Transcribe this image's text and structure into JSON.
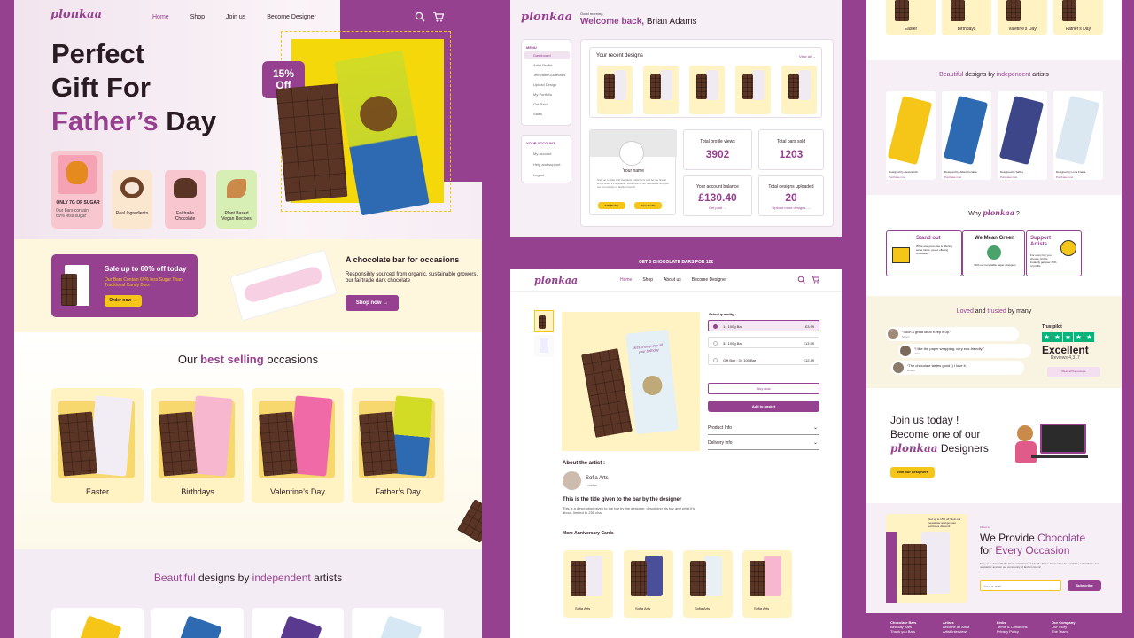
{
  "brand": "plonkaa",
  "p1": {
    "nav": [
      "Home",
      "Shop",
      "Join us",
      "Become Designer"
    ],
    "hero_l1": "Perfect",
    "hero_l2": "Gift For",
    "hero_l3a": "Father’s",
    "hero_l3b": " Day",
    "badge": [
      "15%",
      "Off"
    ],
    "features": [
      {
        "title": "ONLY 7G OF SUGAR",
        "desc": "Our bars contain 69% less sugar"
      },
      {
        "title": "Real Ingredients"
      },
      {
        "title": "Fairtrade Chocolate"
      },
      {
        "title": "Plant Based Vegan Recipes"
      }
    ],
    "promo": {
      "title": "Sale up to 60% off today",
      "sub": "Our Bars Contain 69% less Sugar Than Traditional Candy Bars",
      "btn": "Order now →"
    },
    "occ": {
      "title": "A chocolate bar for occasions",
      "desc": "Responsibly sourced from organic, sustainable growers, our fairtrade dark chocolate",
      "btn": "Shop now →"
    },
    "best_a": "Our ",
    "best_b": "best selling",
    "best_c": " occasions",
    "cards": [
      "Easter",
      "Birthdays",
      "Valentine’s Day",
      "Father’s Day"
    ],
    "designs_a": "Beautiful",
    "designs_b": " designs by ",
    "designs_c": "independent",
    "designs_d": " artists"
  },
  "p2": {
    "greet": "Good morning,",
    "welcome": "Welcome back,",
    "name": "Brian Adams",
    "menu_h": "MENU",
    "menu": [
      "Dashboard",
      "Artist Profile",
      "Template Guidelines",
      "Upload Design",
      "My Portfolio",
      "Get Paid",
      "Sales"
    ],
    "acct_h": "YOUR ACCOUNT",
    "acct": [
      "My account",
      "Help and support",
      "Logout"
    ],
    "recent": "Your recent designs",
    "view_all": "View all →",
    "your_name": "Your name",
    "profile_desc": "Stay up to date with the latest collections and be the first to know when it's available, subscribe to our newsletter and join our community of fashion lovers!",
    "edit": "Edit Profile",
    "view": "View Profile",
    "stats": [
      {
        "label": "Total profile views",
        "value": "3902"
      },
      {
        "label": "Total bars sold",
        "value": "1203"
      },
      {
        "label": "Your account balance",
        "value": "£130.40",
        "link": "Get paid →"
      },
      {
        "label": "Total designs uploaded",
        "value": "20",
        "link": "Upload more designs →"
      }
    ]
  },
  "p3": {
    "banner": "GET 3 CHOCOLATE BARS FOR 12£",
    "nav": [
      "Home",
      "Shop",
      "About us",
      "Become Designer"
    ],
    "qty": "Select quantity :",
    "opts": [
      {
        "l": "1× 100g Bar",
        "p": "£3.99"
      },
      {
        "l": "3× 100g Bar",
        "p": "£13.99"
      },
      {
        "l": "Gift Box : 3× 100 Bar",
        "p": "£12.49"
      }
    ],
    "buy": "Buy now",
    "add": "Add to basket",
    "acc": [
      "Product Info",
      "Delivery info"
    ],
    "about": "About the artist :",
    "artist": "Sofia Arts",
    "loc": "London",
    "ttl": "This is the title given to the bar by the designer",
    "desc": "This is a description given to the bar by the designer, describing his bar and what it's about, limited to 255 char",
    "more": "More Anniversary Cards",
    "wrap_text": "let's chomp into all your birthday",
    "cardart": [
      "Sofia Arts",
      "Sofia Arts",
      "Sofia Arts",
      "Sofia Arts"
    ]
  },
  "p4": {
    "top": [
      "Easter",
      "Birthdays",
      "Valetine's Day",
      "Father's Day"
    ],
    "designs_a": "Beautiful",
    "designs_b": " designs by ",
    "designs_c": "independent",
    "designs_d": " artists",
    "designers": [
      {
        "by": "Designed by Alexandrich",
        "cta": "Purchase now"
      },
      {
        "by": "Designed by Albert Cordeia",
        "cta": "Purchase now"
      },
      {
        "by": "Designed by Saffey",
        "cta": "Purchase now"
      },
      {
        "by": "Designed by Luna Freiza",
        "cta": "Purchase now"
      }
    ],
    "why": "Why",
    "why_q": "?",
    "why_cards": [
      {
        "t": "Stand out",
        "d": "While everyone else is offering some cards, you're offering chocolate"
      },
      {
        "t": "We Mean Green",
        "d": "With our recyclable paper wrappers"
      },
      {
        "t": "Support Artists",
        "d": "For every bar you choose, Artists instantly get over 25% of profits"
      }
    ],
    "loved_a": "Loved",
    "loved_b": " and ",
    "loved_c": "trusted",
    "loved_d": " by many",
    "reviews": [
      {
        "q": "“Such a great idea! Keep it up.”",
        "n": "Sunny"
      },
      {
        "q": "“I like the paper wrapping, very eco-friendly!”",
        "n": "Julia"
      },
      {
        "q": "“The chocolate tastes good ;) I love it.”",
        "n": "Robert"
      }
    ],
    "tp": "Trustpilot",
    "excellent": "Excellent",
    "rev_count": "Reviews 4,317",
    "see": "Read all the reviews",
    "join_l1": "Join us today !",
    "join_l2": "Become one of our",
    "join_d": " Designers",
    "join_btn": "Join our designers",
    "promo_box": "Get up to 15% off ! Join our newsletter and get your exclusive discount",
    "about_tag": "About us",
    "provide_a": "We Provide ",
    "provide_b": "Chocolate",
    "provide_c": "for ",
    "provide_d": "Every Occasion",
    "provide_desc": "Stay up to date with the latest collections and be the first to know when it's available, subscribe to our newsletter and join our community of fashion lovers!",
    "email_ph": "Your e-mail",
    "sub": "Subscribe",
    "footer": [
      {
        "h": "Chocolate Bars",
        "i": [
          "Birthday Bars",
          "Thank you Bars"
        ]
      },
      {
        "h": "Artists",
        "i": [
          "Become an Artist",
          "Artist Interviews"
        ]
      },
      {
        "h": "Links",
        "i": [
          "Terms & Conditions",
          "Privacy Policy"
        ]
      },
      {
        "h": "Our Company",
        "i": [
          "Our Story",
          "The Team"
        ]
      }
    ]
  },
  "colors": {
    "purple": "#96418f",
    "yellow": "#f5c518",
    "cream": "#fff3c4",
    "choc": "#5a3424"
  }
}
